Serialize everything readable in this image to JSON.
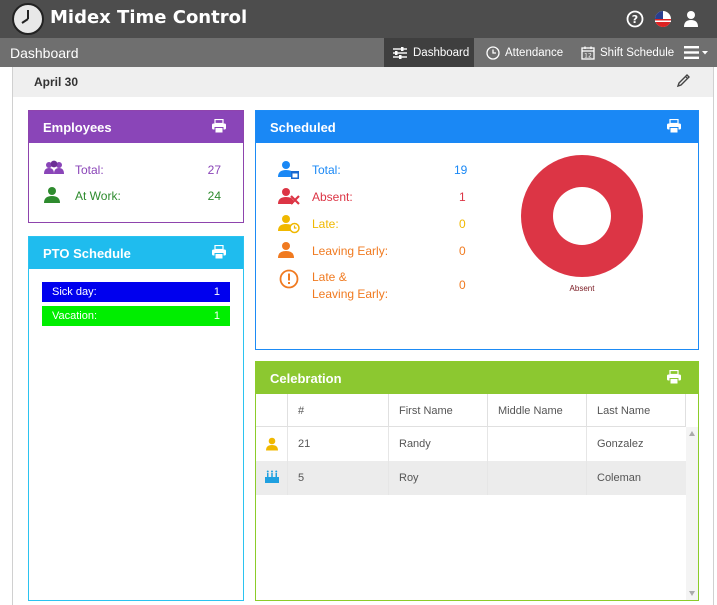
{
  "app": {
    "title": "Midex Time Control"
  },
  "nav": {
    "title": "Dashboard",
    "items": [
      {
        "label": "Dashboard",
        "icon": "sliders-icon"
      },
      {
        "label": "Attendance",
        "icon": "clock-icon"
      },
      {
        "label": "Shift Schedule",
        "icon": "calendar-icon"
      }
    ]
  },
  "date": "April 30",
  "employees": {
    "title": "Employees",
    "rows": [
      {
        "label": "Total:",
        "value": "27",
        "color": "#8a45b8"
      },
      {
        "label": "At Work:",
        "value": "24",
        "color": "#2e8b2e"
      }
    ]
  },
  "pto": {
    "title": "PTO Schedule",
    "items": [
      {
        "label": "Sick day:",
        "value": "1",
        "color": "#0000ee"
      },
      {
        "label": "Vacation:",
        "value": "1",
        "color": "#00ee00"
      }
    ]
  },
  "scheduled": {
    "title": "Scheduled",
    "rows": [
      {
        "label": "Total:",
        "value": "19",
        "color": "#1a88f5"
      },
      {
        "label": "Absent:",
        "value": "1",
        "color": "#dc3545"
      },
      {
        "label": "Late:",
        "value": "0",
        "color": "#f0b800"
      },
      {
        "label": "Leaving Early:",
        "value": "0",
        "color": "#f07a20"
      },
      {
        "label_1": "Late &",
        "label_2": "Leaving Early:",
        "value": "0",
        "color": "#f07a20"
      }
    ],
    "donut_label": "Absent"
  },
  "celebration": {
    "title": "Celebration",
    "columns": [
      "",
      "#",
      "First Name",
      "Middle Name",
      "Last Name"
    ],
    "rows": [
      {
        "icon": "person-icon",
        "num": "21",
        "first": "Randy",
        "middle": "",
        "last": "Gonzalez"
      },
      {
        "icon": "cake-icon",
        "num": "5",
        "first": "Roy",
        "middle": "",
        "last": "Coleman"
      }
    ]
  }
}
